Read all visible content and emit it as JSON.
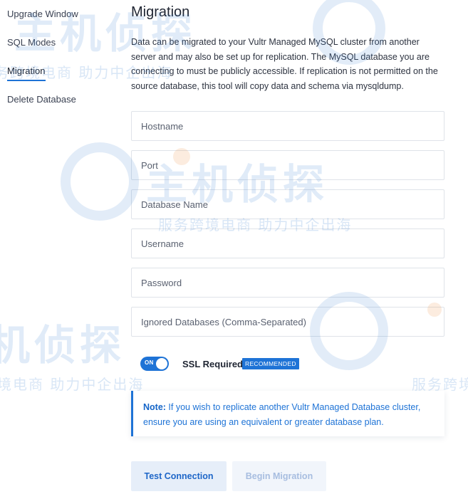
{
  "sidebar": {
    "items": [
      {
        "label": "Upgrade Window"
      },
      {
        "label": "SQL Modes"
      },
      {
        "label": "Migration",
        "active": true
      },
      {
        "label": "Delete Database"
      }
    ]
  },
  "main": {
    "title": "Migration",
    "description": "Data can be migrated to your Vultr Managed MySQL cluster from another server and may also be set up for replication. The MySQL database you are connecting to must be publicly accessible. If replication is not permitted on the source database, this tool will copy data and schema via mysqldump.",
    "fields": {
      "hostname": {
        "placeholder": "Hostname",
        "value": ""
      },
      "port": {
        "placeholder": "Port",
        "value": ""
      },
      "database_name": {
        "placeholder": "Database Name",
        "value": ""
      },
      "username": {
        "placeholder": "Username",
        "value": ""
      },
      "password": {
        "placeholder": "Password",
        "value": ""
      },
      "ignored_databases": {
        "placeholder": "Ignored Databases (Comma-Separated)",
        "value": ""
      }
    },
    "ssl": {
      "toggle_state": "ON",
      "enabled": true,
      "label": "SSL Required",
      "badge": "RECOMMENDED"
    },
    "note": {
      "prefix": "Note:",
      "text": " If you wish to replicate another Vultr Managed Database cluster, ensure you are using an equivalent or greater database plan."
    },
    "buttons": {
      "test_connection": "Test Connection",
      "begin_migration": "Begin Migration"
    }
  },
  "watermark": {
    "logo_text": "主机侦探",
    "slogan": "服务跨境电商 助力中企出海"
  },
  "colors": {
    "accent": "#1e73d6",
    "button_secondary_bg": "#e6eef9",
    "button_disabled_text": "#a7bde0",
    "watermark": "#3c82d2"
  }
}
